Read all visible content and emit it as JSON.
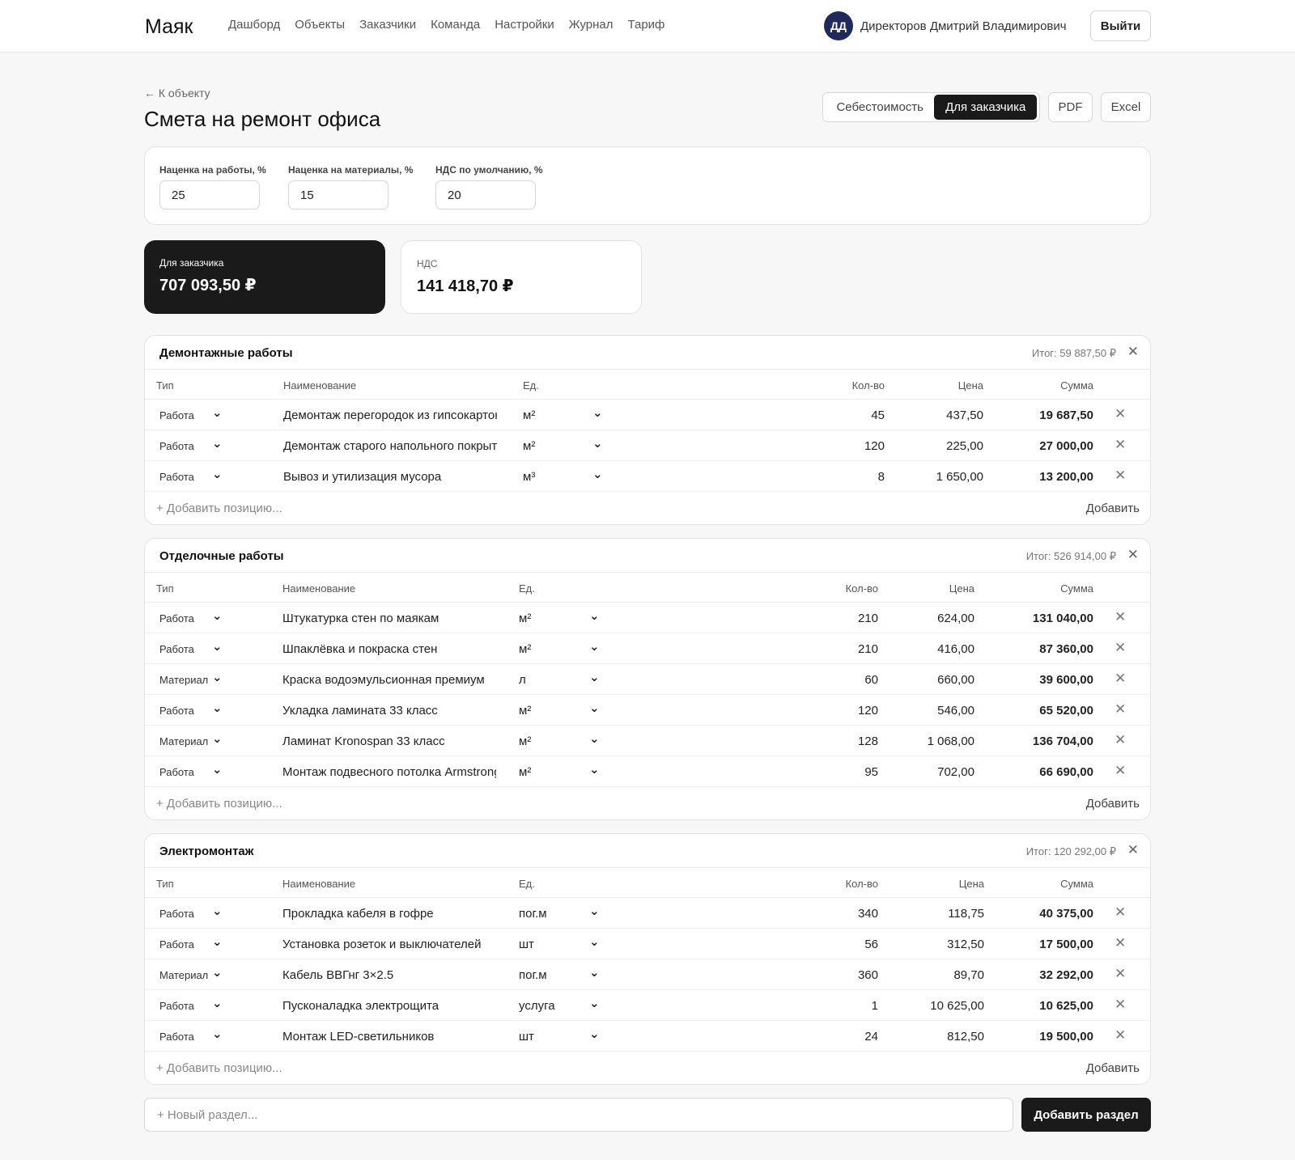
{
  "app": {
    "brand": "Маяк",
    "nav": [
      "Дашборд",
      "Объекты",
      "Заказчики",
      "Команда",
      "Настройки",
      "Журнал",
      "Тариф"
    ],
    "user": {
      "initials": "ДД",
      "name": "Директоров Дмитрий Владимирович"
    },
    "logout": "Выйти"
  },
  "page": {
    "back": "← К объекту",
    "title": "Смета на ремонт офиса",
    "view_toggle": {
      "cost": "Себестоимость",
      "client": "Для заказчика",
      "selected": "client"
    },
    "pdf": "PDF",
    "excel": "Excel"
  },
  "settings": {
    "work_markup": {
      "label": "Наценка на работы, %",
      "value": "25"
    },
    "material_markup": {
      "label": "Наценка на материалы, %",
      "value": "15"
    },
    "vat": {
      "label": "НДС по умолчанию, %",
      "value": "20"
    }
  },
  "totals": {
    "client": {
      "label": "Для заказчика",
      "value": "707 093,50 ₽"
    },
    "vat": {
      "label": "НДС",
      "value": "141 418,70 ₽"
    }
  },
  "table_headers": {
    "type": "Тип",
    "name": "Наименование",
    "unit": "Ед.",
    "qty": "Кол-во",
    "price": "Цена",
    "sum": "Сумма"
  },
  "add_position_placeholder": "+ Добавить позицию...",
  "add_label": "Добавить",
  "sections": [
    {
      "title": "Демонтажные работы",
      "total": "Итог: 59 887,50 ₽",
      "rows": [
        {
          "type": "Работа",
          "name": "Демонтаж перегородок из гипсокартона",
          "unit": "м²",
          "qty": "45",
          "price": "437,50",
          "sum": "19 687,50"
        },
        {
          "type": "Работа",
          "name": "Демонтаж старого напольного покрытия",
          "unit": "м²",
          "qty": "120",
          "price": "225,00",
          "sum": "27 000,00"
        },
        {
          "type": "Работа",
          "name": "Вывоз и утилизация мусора",
          "unit": "м³",
          "qty": "8",
          "price": "1 650,00",
          "sum": "13 200,00"
        }
      ]
    },
    {
      "title": "Отделочные работы",
      "total": "Итог: 526 914,00 ₽",
      "rows": [
        {
          "type": "Работа",
          "name": "Штукатурка стен по маякам",
          "unit": "м²",
          "qty": "210",
          "price": "624,00",
          "sum": "131 040,00"
        },
        {
          "type": "Работа",
          "name": "Шпаклёвка и покраска стен",
          "unit": "м²",
          "qty": "210",
          "price": "416,00",
          "sum": "87 360,00"
        },
        {
          "type": "Материал",
          "name": "Краска водоэмульсионная премиум",
          "unit": "л",
          "qty": "60",
          "price": "660,00",
          "sum": "39 600,00"
        },
        {
          "type": "Работа",
          "name": "Укладка ламината 33 класс",
          "unit": "м²",
          "qty": "120",
          "price": "546,00",
          "sum": "65 520,00"
        },
        {
          "type": "Материал",
          "name": "Ламинат Kronospan 33 класс",
          "unit": "м²",
          "qty": "128",
          "price": "1 068,00",
          "sum": "136 704,00"
        },
        {
          "type": "Работа",
          "name": "Монтаж подвесного потолка Armstrong",
          "unit": "м²",
          "qty": "95",
          "price": "702,00",
          "sum": "66 690,00"
        }
      ]
    },
    {
      "title": "Электромонтаж",
      "total": "Итог: 120 292,00 ₽",
      "rows": [
        {
          "type": "Работа",
          "name": "Прокладка кабеля в гофре",
          "unit": "пог.м",
          "qty": "340",
          "price": "118,75",
          "sum": "40 375,00"
        },
        {
          "type": "Работа",
          "name": "Установка розеток и выключателей",
          "unit": "шт",
          "qty": "56",
          "price": "312,50",
          "sum": "17 500,00"
        },
        {
          "type": "Материал",
          "name": "Кабель ВВГнг 3×2.5",
          "unit": "пог.м",
          "qty": "360",
          "price": "89,70",
          "sum": "32 292,00"
        },
        {
          "type": "Работа",
          "name": "Пусконаладка электрощита",
          "unit": "услуга",
          "qty": "1",
          "price": "10 625,00",
          "sum": "10 625,00"
        },
        {
          "type": "Работа",
          "name": "Монтаж LED-светильников",
          "unit": "шт",
          "qty": "24",
          "price": "812,50",
          "sum": "19 500,00"
        }
      ]
    }
  ],
  "new_section": {
    "placeholder": "+ Новый раздел...",
    "button": "Добавить раздел"
  }
}
